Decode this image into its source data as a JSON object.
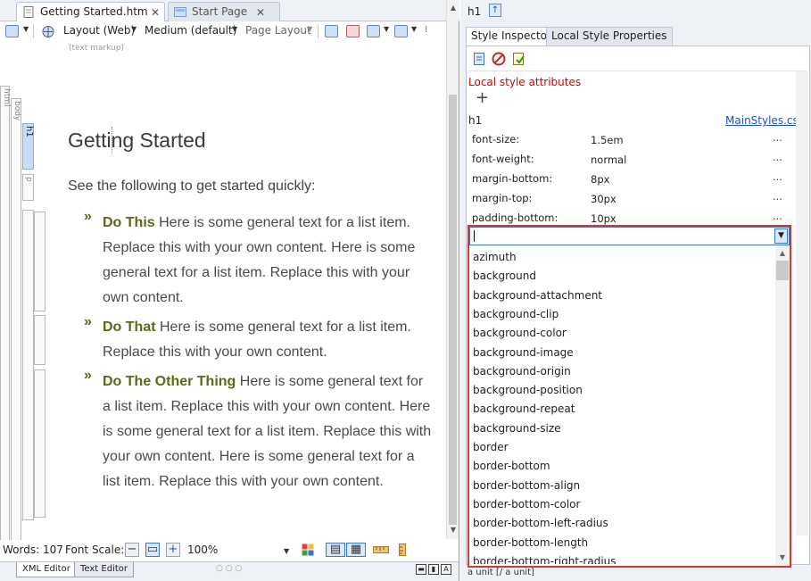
{
  "tabs": [
    {
      "label": "Getting Started.htm",
      "active": true
    },
    {
      "label": "Start Page",
      "active": false
    }
  ],
  "toolbar": {
    "layout": "Layout (Web)",
    "size": "Medium (default)",
    "page_layout": "Page Layout"
  },
  "markup_hint": "(text markup)",
  "tag_bars": {
    "html": "html",
    "body": "body",
    "h1": "h1",
    "p": "p"
  },
  "document": {
    "title": "Getting Started",
    "intro": "See the following to get started quickly:",
    "bullet": "»",
    "items": [
      {
        "bold": "Do This",
        "text": " Here is some general text for a list item. Replace this with your own content. Here is some general text for a list item. Replace this with your own content."
      },
      {
        "bold": "Do That",
        "text": " Here is some general text for a list item. Replace this with your own content."
      },
      {
        "bold": "Do The Other Thing",
        "text": " Here is some general text for a list item. Replace this with your own content. Here is some general text for a list item. Replace this with your own content. Here is some general text for a list item. Replace this with your own content."
      }
    ]
  },
  "status": {
    "words": "Words: 107",
    "font_scale": "Font Scale:",
    "zoom": "100%"
  },
  "bottom_tabs": [
    "XML Editor",
    "Text Editor"
  ],
  "inspector": {
    "element": "h1",
    "tabs": [
      "Style Inspector",
      "Local Style Properties"
    ],
    "local_attrs": "Local style attributes",
    "add": "+",
    "selector": "h1",
    "source": "MainStyles.css",
    "properties": [
      {
        "name": "font-size:",
        "value": "1.5em"
      },
      {
        "name": "font-weight:",
        "value": "normal"
      },
      {
        "name": "margin-bottom:",
        "value": "8px"
      },
      {
        "name": "margin-top:",
        "value": "30px"
      },
      {
        "name": "padding-bottom:",
        "value": "10px"
      }
    ],
    "more": "...",
    "combo_value": "",
    "options": [
      "azimuth",
      "background",
      "background-attachment",
      "background-clip",
      "background-color",
      "background-image",
      "background-origin",
      "background-position",
      "background-repeat",
      "background-size",
      "border",
      "border-bottom",
      "border-bottom-align",
      "border-bottom-color",
      "border-bottom-left-radius",
      "border-bottom-length",
      "border-bottom-right-radius"
    ],
    "unit_hint": "a unit [/ a unit]"
  },
  "colors": {
    "accent_red": "#d33a2c",
    "bold_green": "#5a6a14",
    "link_blue": "#1a55b0"
  }
}
